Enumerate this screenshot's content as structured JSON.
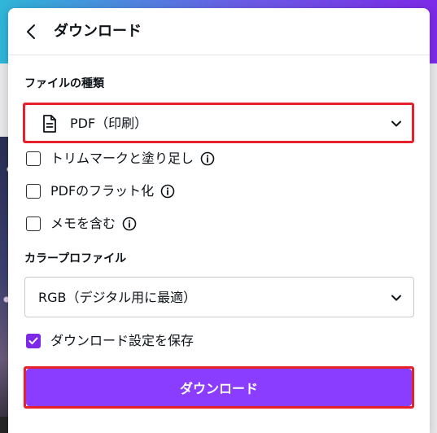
{
  "panel": {
    "title": "ダウンロード"
  },
  "file_type": {
    "label": "ファイルの種類",
    "selected": "PDF（印刷）",
    "icon": "document-icon"
  },
  "options": [
    {
      "label": "トリムマークと塗り足し",
      "checked": false,
      "info": true
    },
    {
      "label": "PDFのフラット化",
      "checked": false,
      "info": true
    },
    {
      "label": "メモを含む",
      "checked": false,
      "info": true
    }
  ],
  "color_profile": {
    "label": "カラープロファイル",
    "selected": "RGB（デジタル用に最適）"
  },
  "save_settings": {
    "label": "ダウンロード設定を保存",
    "checked": true
  },
  "download_button": {
    "label": "ダウンロード"
  },
  "colors": {
    "accent": "#8b3dff",
    "checkbox_checked": "#7d2ae8",
    "highlight": "#e5212d"
  }
}
